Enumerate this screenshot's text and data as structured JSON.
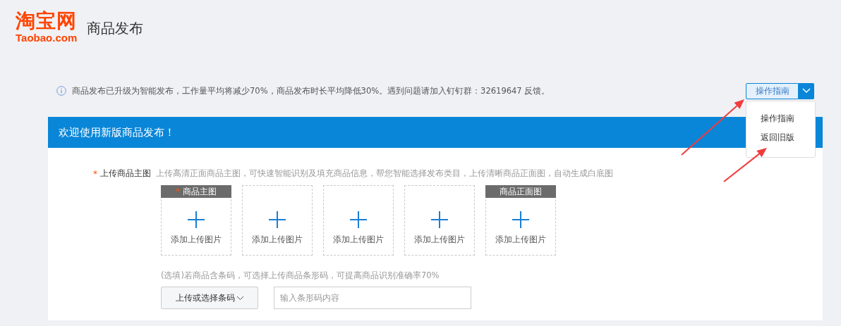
{
  "logo": {
    "name": "淘宝网",
    "domain": "Taobao.com"
  },
  "page_title": "商品发布",
  "notice": "商品发布已升级为智能发布，工作量平均将减少70%，商品发布时长平均降低30%。遇到问题请加入钉钉群：32619647 反馈。",
  "guide_button": {
    "label": "操作指南",
    "expanded": true
  },
  "guide_menu": [
    "操作指南",
    "返回旧版"
  ],
  "banner": "欢迎使用新版商品发布！",
  "main_image": {
    "label": "上传商品主图",
    "required_mark": "*",
    "hint": "上传高清正面商品主图，可快速智能识别及填充商品信息，帮您智能选择发布类目，上传清晰商品正面图，自动生成白底图"
  },
  "slots": [
    {
      "header": "商品主图",
      "required_mark": "*",
      "label": "添加上传图片"
    },
    {
      "label": "添加上传图片"
    },
    {
      "label": "添加上传图片"
    },
    {
      "label": "添加上传图片"
    },
    {
      "header": "商品正面图",
      "label": "添加上传图片"
    }
  ],
  "barcode": {
    "hint": "(选填)若商品含条码，可选择上传商品条形码，可提高商品识别准确率70%",
    "button": "上传或选择条码",
    "placeholder": "输入条形码内容"
  }
}
